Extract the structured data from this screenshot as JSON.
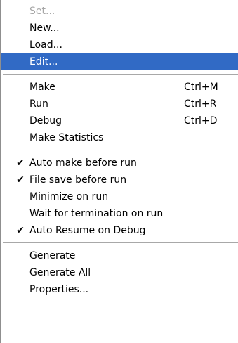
{
  "menu": {
    "groups": [
      [
        {
          "label": "Set...",
          "state": "disabled"
        },
        {
          "label": "New..."
        },
        {
          "label": "Load..."
        },
        {
          "label": "Edit...",
          "state": "highlighted"
        }
      ],
      [
        {
          "label": "Make",
          "shortcut": "Ctrl+M"
        },
        {
          "label": "Run",
          "shortcut": "Ctrl+R"
        },
        {
          "label": "Debug",
          "shortcut": "Ctrl+D"
        },
        {
          "label": "Make Statistics"
        }
      ],
      [
        {
          "label": "Auto make before run",
          "checked": true
        },
        {
          "label": "File save before run",
          "checked": true
        },
        {
          "label": "Minimize on run"
        },
        {
          "label": "Wait for termination on run"
        },
        {
          "label": "Auto Resume on Debug",
          "checked": true
        }
      ],
      [
        {
          "label": "Generate"
        },
        {
          "label": "Generate All"
        },
        {
          "label": "Properties..."
        }
      ]
    ],
    "check_glyph": "✔",
    "colors": {
      "highlight": "#316ac5",
      "disabled_text": "#a6a6a6",
      "separator": "#a8a8a8"
    }
  }
}
